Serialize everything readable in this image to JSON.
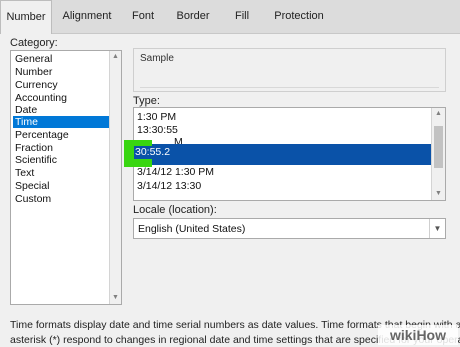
{
  "tabs": [
    "Number",
    "Alignment",
    "Font",
    "Border",
    "Fill",
    "Protection"
  ],
  "category": {
    "label": "Category:",
    "items": [
      "General",
      "Number",
      "Currency",
      "Accounting",
      "Date",
      "Time",
      "Percentage",
      "Fraction",
      "Scientific",
      "Text",
      "Special",
      "Custom"
    ],
    "selected": "Time"
  },
  "sample": {
    "label": "Sample"
  },
  "type": {
    "label": "Type:",
    "items": [
      "1:30 PM",
      "13:30:55",
      "M",
      "30:55.2",
      "3/14/12 1:30 PM",
      "3/14/12 13:30"
    ],
    "selected": "30:55.2"
  },
  "locale": {
    "label": "Locale (location):",
    "value": "English (United States)"
  },
  "description": {
    "line1": "Time formats display date and time serial numbers as date values.  Time formats that begin with an",
    "line2": "asterisk (*) respond to changes in regional date and time settings that are specified for your operating"
  },
  "watermark": "wikiHow",
  "colors": {
    "selection": "#0078d7",
    "type_selection": "#0a52a8",
    "highlight": "#39d611"
  }
}
